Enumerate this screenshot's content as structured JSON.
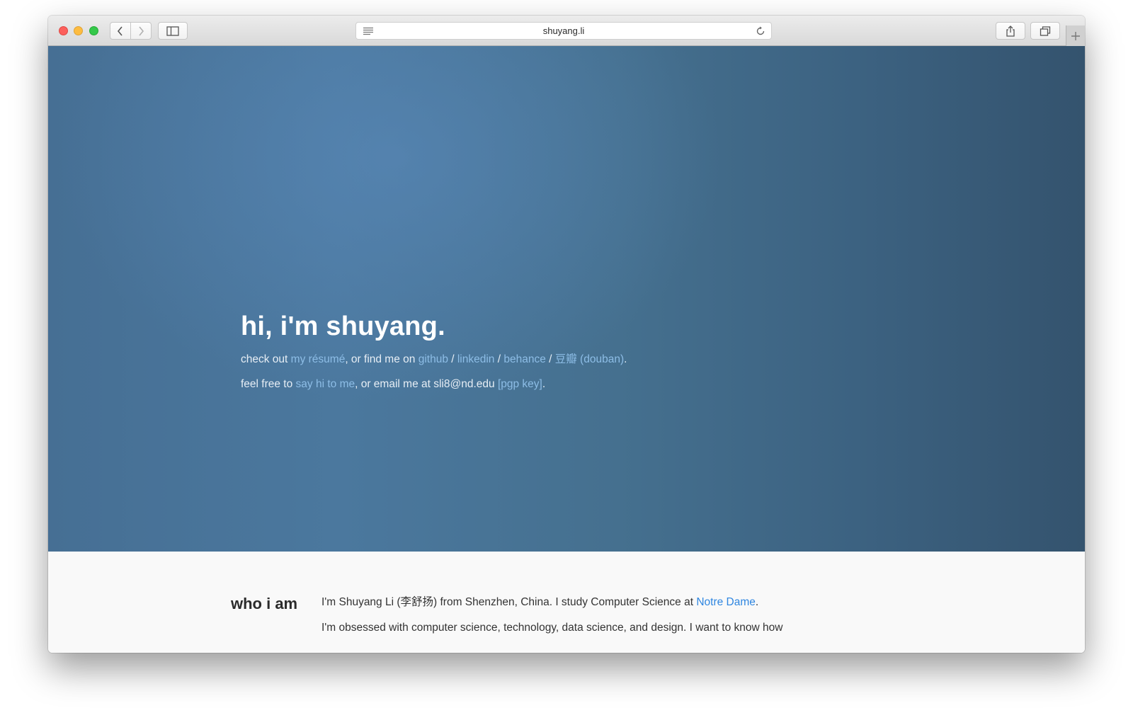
{
  "browser": {
    "url": "shuyang.li",
    "traffic_lights": [
      "close",
      "minimize",
      "maximize"
    ],
    "icons": {
      "back": "chevron-left-icon",
      "forward": "chevron-right-icon",
      "sidebar": "sidebar-icon",
      "reader": "reader-icon",
      "reload": "reload-icon",
      "share": "share-icon",
      "tabs": "tabs-icon",
      "new_tab": "plus-icon"
    }
  },
  "hero": {
    "heading": "hi, i'm shuyang.",
    "line1": {
      "prefix": "check out ",
      "resume": "my résumé",
      "mid": ", or find me on ",
      "github": "github",
      "sep1": " / ",
      "linkedin": "linkedin",
      "sep2": " / ",
      "behance": "behance",
      "sep3": " / ",
      "douban": "豆瓣 (douban)",
      "end": "."
    },
    "line2": {
      "prefix": "feel free to ",
      "sayhi": "say hi to me",
      "mid": ", or email me at sli8@nd.edu ",
      "pgp": "[pgp key]",
      "end": "."
    }
  },
  "about": {
    "title": "who i am",
    "p1_prefix": "I'm Shuyang Li (李舒扬) from Shenzhen, China. I study Computer Science at ",
    "p1_link": "Notre Dame",
    "p1_end": ".",
    "p2": "I'm obsessed with computer science, technology, data science, and design. I want to know how"
  },
  "colors": {
    "hero_bg": "#4b789e",
    "link_hero": "#8dbde6",
    "link_body": "#2f86e0"
  }
}
